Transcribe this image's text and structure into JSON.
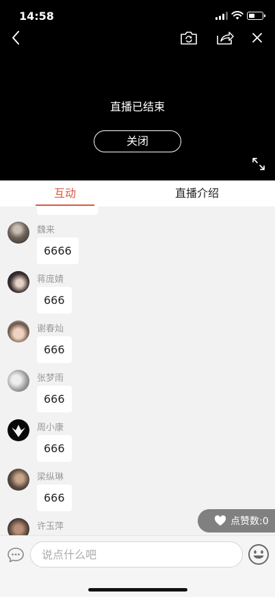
{
  "status_bar": {
    "time": "14:58"
  },
  "player": {
    "ended_text": "直播已结束",
    "close_label": "关闭"
  },
  "tabs": [
    {
      "label": "互动",
      "active": true
    },
    {
      "label": "直播介绍",
      "active": false
    }
  ],
  "comments": [
    {
      "user": "魏来",
      "text": "6666"
    },
    {
      "user": "蒋庞婧",
      "text": "666"
    },
    {
      "user": "谢春灿",
      "text": "666"
    },
    {
      "user": "张梦雨",
      "text": "666"
    },
    {
      "user": "周小康",
      "text": "666"
    },
    {
      "user": "梁纵琳",
      "text": "666"
    },
    {
      "user": "许玉萍",
      "text": ""
    }
  ],
  "likes": {
    "label": "点赞数:0"
  },
  "input": {
    "placeholder": "说点什么吧"
  },
  "colors": {
    "accent": "#d9573c",
    "video_bg": "#000000",
    "like_pill": "#808080"
  },
  "icons": [
    "back-icon",
    "camera-flip-icon",
    "share-icon",
    "close-icon",
    "fullscreen-icon",
    "heart-icon",
    "chat-bubble-icon",
    "emoji-icon"
  ]
}
